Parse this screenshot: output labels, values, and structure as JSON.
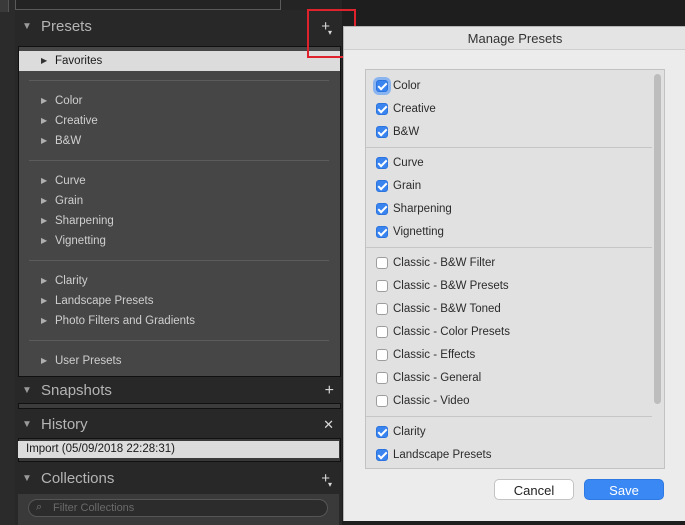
{
  "left_panel": {
    "presets": {
      "title": "Presets",
      "add_icon": "plus-with-dropdown",
      "groups": [
        [
          "Favorites"
        ],
        [
          "Color",
          "Creative",
          "B&W"
        ],
        [
          "Curve",
          "Grain",
          "Sharpening",
          "Vignetting"
        ],
        [
          "Clarity",
          "Landscape Presets",
          "Photo Filters and Gradients"
        ],
        [
          "User Presets"
        ]
      ],
      "selected": "Favorites"
    },
    "snapshots": {
      "title": "Snapshots",
      "action_icon": "plus"
    },
    "history": {
      "title": "History",
      "action_icon": "close",
      "entries": [
        "Import (05/09/2018 22:28:31)"
      ]
    },
    "collections": {
      "title": "Collections",
      "action_icon": "plus-with-dropdown",
      "filter_placeholder": "Filter Collections"
    }
  },
  "dialog": {
    "title": "Manage Presets",
    "groups": [
      [
        {
          "label": "Color",
          "checked": true,
          "focused": true
        },
        {
          "label": "Creative",
          "checked": true
        },
        {
          "label": "B&W",
          "checked": true
        }
      ],
      [
        {
          "label": "Curve",
          "checked": true
        },
        {
          "label": "Grain",
          "checked": true
        },
        {
          "label": "Sharpening",
          "checked": true
        },
        {
          "label": "Vignetting",
          "checked": true
        }
      ],
      [
        {
          "label": "Classic - B&W Filter",
          "checked": false
        },
        {
          "label": "Classic - B&W Presets",
          "checked": false
        },
        {
          "label": "Classic - B&W Toned",
          "checked": false
        },
        {
          "label": "Classic - Color Presets",
          "checked": false
        },
        {
          "label": "Classic - Effects",
          "checked": false
        },
        {
          "label": "Classic - General",
          "checked": false
        },
        {
          "label": "Classic - Video",
          "checked": false
        }
      ],
      [
        {
          "label": "Clarity",
          "checked": true
        },
        {
          "label": "Landscape Presets",
          "checked": true
        }
      ]
    ],
    "cancel_label": "Cancel",
    "save_label": "Save"
  },
  "colors": {
    "accent": "#3a88f4",
    "highlight_box": "#e0222c",
    "panel_bg": "#464646"
  }
}
